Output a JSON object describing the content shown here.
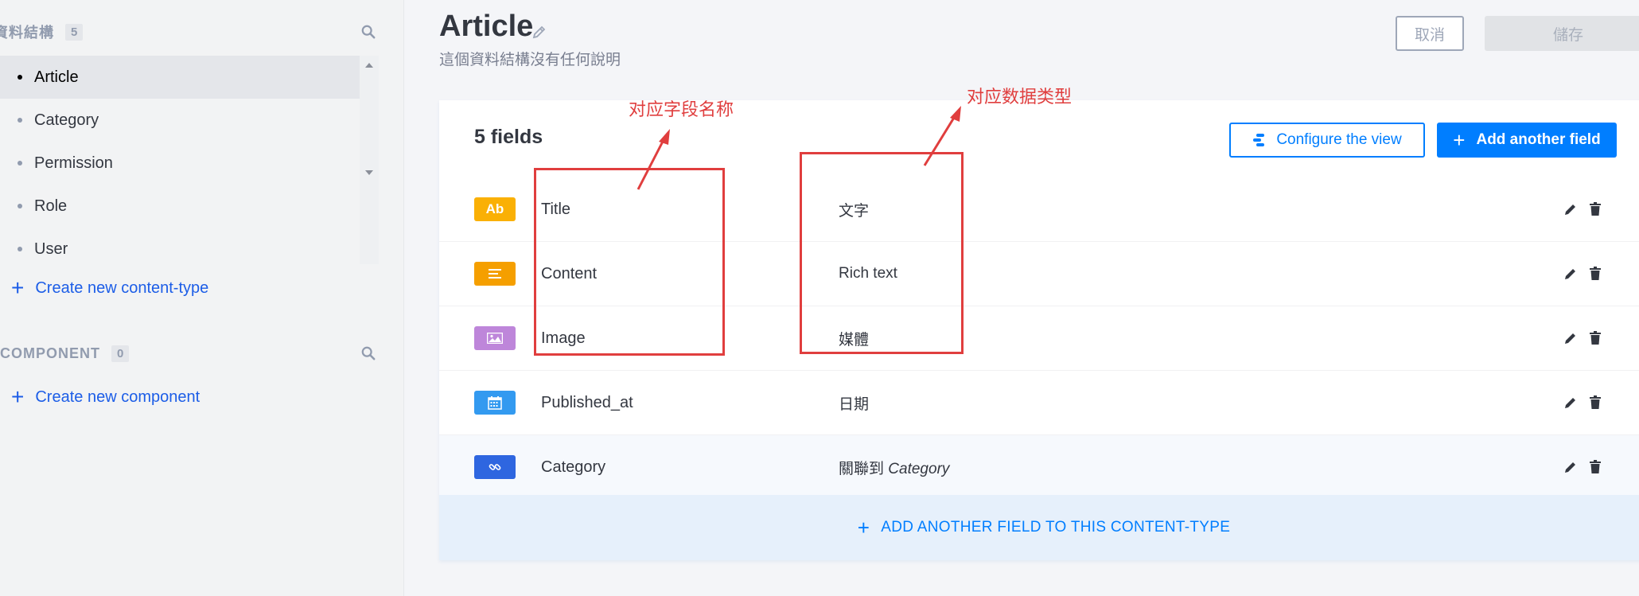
{
  "sidebar": {
    "content_types": {
      "title": "資料結構",
      "count": "5",
      "items": [
        {
          "label": "Article"
        },
        {
          "label": "Category"
        },
        {
          "label": "Permission"
        },
        {
          "label": "Role"
        },
        {
          "label": "User"
        }
      ],
      "create_label": "Create new content-type"
    },
    "components": {
      "title": "COMPONENT",
      "count": "0",
      "create_label": "Create new component"
    }
  },
  "header": {
    "title": "Article",
    "description": "這個資料結構沒有任何說明",
    "cancel_label": "取消",
    "save_label": "儲存"
  },
  "card": {
    "title": "5 fields",
    "configure_label": "Configure the view",
    "add_label": "Add another field",
    "fields": [
      {
        "icon_text": "Ab",
        "name": "Title",
        "type": "文字",
        "color": "#fab005"
      },
      {
        "icon_text": "",
        "name": "Content",
        "type": "Rich text",
        "color": "#f59f00"
      },
      {
        "icon_text": "",
        "name": "Image",
        "type": "媒體",
        "color": "#be86da"
      },
      {
        "icon_text": "",
        "name": "Published_at",
        "type": "日期",
        "color": "#339af0"
      },
      {
        "icon_text": "",
        "name": "Category",
        "type_prefix": "關聯到",
        "type_italic": "Category",
        "color": "#2e66e0"
      }
    ],
    "footer_add_label": "ADD ANOTHER FIELD TO THIS CONTENT-TYPE"
  },
  "annotations": {
    "field_name": "对应字段名称",
    "data_type": "对应数据类型",
    "color": "#e03e3e"
  },
  "colors": {
    "primary": "#007eff",
    "link": "#1c5de7"
  }
}
